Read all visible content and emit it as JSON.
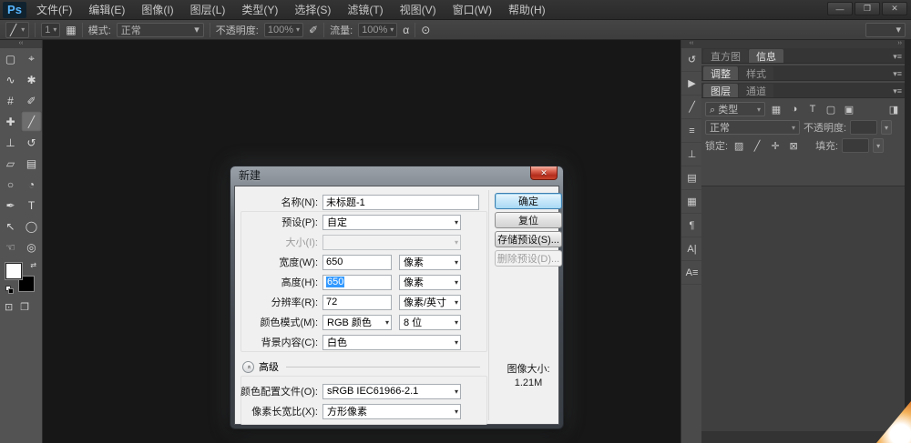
{
  "window": {
    "logo": "Ps",
    "controls": {
      "minimize": "—",
      "restore": "❐",
      "close": "✕"
    }
  },
  "menu_bar": {
    "items": [
      {
        "name": "menu-file",
        "label": "文件(F)"
      },
      {
        "name": "menu-edit",
        "label": "编辑(E)"
      },
      {
        "name": "menu-image",
        "label": "图像(I)"
      },
      {
        "name": "menu-layer",
        "label": "图层(L)"
      },
      {
        "name": "menu-type",
        "label": "类型(Y)"
      },
      {
        "name": "menu-select",
        "label": "选择(S)"
      },
      {
        "name": "menu-filter",
        "label": "滤镜(T)"
      },
      {
        "name": "menu-view",
        "label": "视图(V)"
      },
      {
        "name": "menu-window",
        "label": "窗口(W)"
      },
      {
        "name": "menu-help",
        "label": "帮助(H)"
      }
    ]
  },
  "options_bar": {
    "brush_glyph": "╱",
    "brush_size": "1",
    "panel_toggle_glyph": "▦",
    "mode_label": "模式:",
    "mode_value": "正常",
    "opacity_label": "不透明度:",
    "opacity_value": "100%",
    "tablet_opacity_glyph": "✐",
    "flow_label": "流量:",
    "flow_value": "100%",
    "airbrush_glyph": "α",
    "tablet_size_glyph": "⊙",
    "arrow": "▾",
    "collapse_glyph": "‹‹"
  },
  "toolbar": {
    "tools": [
      {
        "name": "rectangular-marquee-tool",
        "glyph": "▢"
      },
      {
        "name": "move-tool",
        "glyph": "⌖"
      },
      {
        "name": "lasso-tool",
        "glyph": "∿"
      },
      {
        "name": "magic-wand-tool",
        "glyph": "✱"
      },
      {
        "name": "crop-tool",
        "glyph": "#"
      },
      {
        "name": "eyedropper-tool",
        "glyph": "✐"
      },
      {
        "name": "healing-brush-tool",
        "glyph": "✚"
      },
      {
        "name": "brush-tool",
        "glyph": "╱",
        "selected": true
      },
      {
        "name": "clone-stamp-tool",
        "glyph": "⊥"
      },
      {
        "name": "history-brush-tool",
        "glyph": "↺"
      },
      {
        "name": "eraser-tool",
        "glyph": "▱"
      },
      {
        "name": "gradient-tool",
        "glyph": "▤"
      },
      {
        "name": "blur-tool",
        "glyph": "○"
      },
      {
        "name": "dodge-tool",
        "glyph": "◔"
      },
      {
        "name": "pen-tool",
        "glyph": "✒"
      },
      {
        "name": "type-tool",
        "glyph": "T"
      },
      {
        "name": "path-selection-tool",
        "glyph": "↖"
      },
      {
        "name": "ellipse-tool",
        "glyph": "◯"
      },
      {
        "name": "hand-tool",
        "glyph": "☜"
      },
      {
        "name": "zoom-tool",
        "glyph": "◎"
      }
    ],
    "swap_glyph": "⇄",
    "quick_mask_glyph": "⊡",
    "screen_mode_glyph": "❐"
  },
  "dock": {
    "collapse_glyph": "‹‹",
    "icons": [
      {
        "name": "history-panel-icon",
        "glyph": "↺"
      },
      {
        "name": "actions-panel-icon",
        "glyph": "▶"
      },
      {
        "name": "brush-panel-icon",
        "glyph": "╱"
      },
      {
        "name": "brush-presets-panel-icon",
        "glyph": "≡"
      },
      {
        "name": "clone-source-panel-icon",
        "glyph": "⊥"
      },
      {
        "name": "notes-panel-icon",
        "glyph": "▤"
      },
      {
        "name": "properties-panel-icon",
        "glyph": "▦"
      },
      {
        "name": "paragraph-panel-icon",
        "glyph": "¶"
      },
      {
        "name": "character-panel-icon",
        "glyph": "A|"
      },
      {
        "name": "character-styles-panel-icon",
        "glyph": "A≡"
      }
    ]
  },
  "panels": {
    "expand_glyph": "››",
    "menu_glyph": "▾≡",
    "tab_rows": [
      {
        "tabs": [
          {
            "label": "直方图"
          },
          {
            "label": "信息"
          }
        ]
      },
      {
        "tabs": [
          {
            "label": "调整"
          },
          {
            "label": "样式"
          }
        ]
      },
      {
        "tabs": [
          {
            "label": "图层"
          },
          {
            "label": "通道"
          }
        ]
      }
    ],
    "layers": {
      "search_glyph": "⌕",
      "filter_label": "类型",
      "filter_icons": [
        {
          "name": "filter-pixel-layers-icon",
          "glyph": "▦"
        },
        {
          "name": "filter-adjustment-layers-icon",
          "glyph": "◑"
        },
        {
          "name": "filter-type-layers-icon",
          "glyph": "T"
        },
        {
          "name": "filter-shape-layers-icon",
          "glyph": "▢"
        },
        {
          "name": "filter-smart-objects-icon",
          "glyph": "▣"
        }
      ],
      "filter_toggle_glyph": "◨",
      "blend_value": "正常",
      "opacity_label": "不透明度:",
      "lock_label": "锁定:",
      "lock_icons": [
        {
          "name": "lock-transparency-icon",
          "glyph": "▨"
        },
        {
          "name": "lock-paint-icon",
          "glyph": "╱"
        },
        {
          "name": "lock-position-icon",
          "glyph": "✛"
        },
        {
          "name": "lock-all-icon",
          "glyph": "⊠"
        }
      ],
      "fill_label": "填充:",
      "arrow": "▾"
    }
  },
  "dialog": {
    "title": "新建",
    "close_glyph": "✕",
    "name_label": "名称(N):",
    "name_value": "未标题-1",
    "preset_label": "预设(P):",
    "preset_value": "自定",
    "size_label": "大小(I):",
    "size_value": "",
    "width_label": "宽度(W):",
    "width_value": "650",
    "width_unit": "像素",
    "height_label": "高度(H):",
    "height_value": "650",
    "height_unit": "像素",
    "resolution_label": "分辨率(R):",
    "resolution_value": "72",
    "resolution_unit": "像素/英寸",
    "color_mode_label": "颜色模式(M):",
    "color_mode_value": "RGB 颜色",
    "bit_depth_value": "8 位",
    "background_label": "背景内容(C):",
    "background_value": "白色",
    "advanced_toggle_glyph": "«",
    "advanced_label": "高级",
    "profile_label": "颜色配置文件(O):",
    "profile_value": "sRGB IEC61966-2.1",
    "aspect_label": "像素长宽比(X):",
    "aspect_value": "方形像素",
    "ok_label": "确定",
    "reset_label": "复位",
    "save_preset_label": "存储预设(S)...",
    "delete_preset_label": "删除预设(D)...",
    "image_size_label": "图像大小:",
    "image_size_value": "1.21M",
    "arrow": "▾"
  }
}
